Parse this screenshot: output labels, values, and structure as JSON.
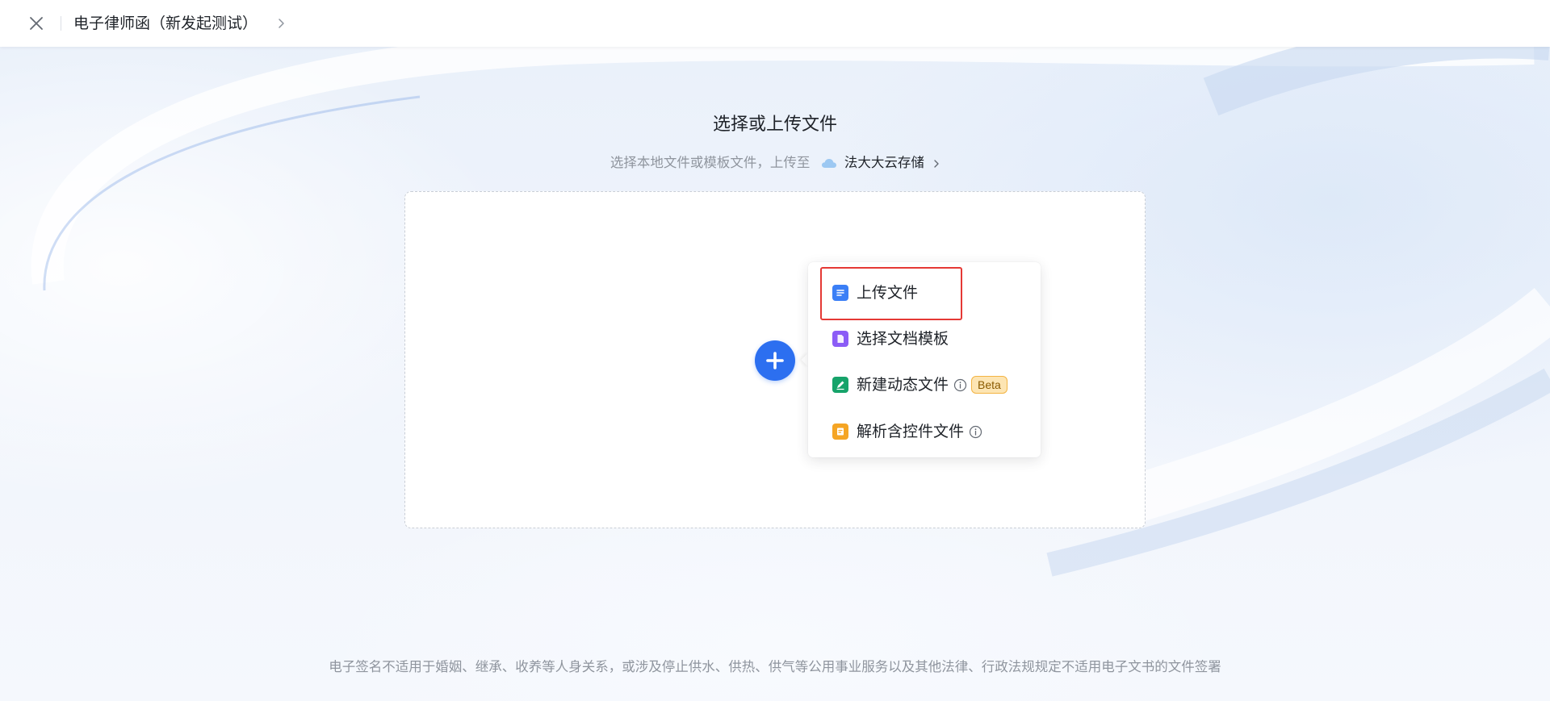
{
  "header": {
    "title": "电子律师函（新发起测试）"
  },
  "main": {
    "title": "选择或上传文件",
    "subtitle_prefix": "选择本地文件或模板文件，上传至",
    "storage_link": "法大大云存储"
  },
  "menu": {
    "items": [
      {
        "label": "上传文件",
        "icon": "document-icon",
        "color": "#3b7ff6"
      },
      {
        "label": "选择文档模板",
        "icon": "template-icon",
        "color": "#8b5cf6"
      },
      {
        "label": "新建动态文件",
        "icon": "edit-icon",
        "color": "#16a36a",
        "badge": "Beta"
      },
      {
        "label": "解析含控件文件",
        "icon": "form-icon",
        "color": "#f5a524"
      }
    ]
  },
  "footer": {
    "note": "电子签名不适用于婚姻、继承、收养等人身关系，或涉及停止供水、供热、供气等公用事业服务以及其他法律、行政法规规定不适用电子文书的文件签署"
  },
  "colors": {
    "accent": "#2c6ff0",
    "highlight": "#e53935",
    "beta_bg": "#fde5b3"
  }
}
